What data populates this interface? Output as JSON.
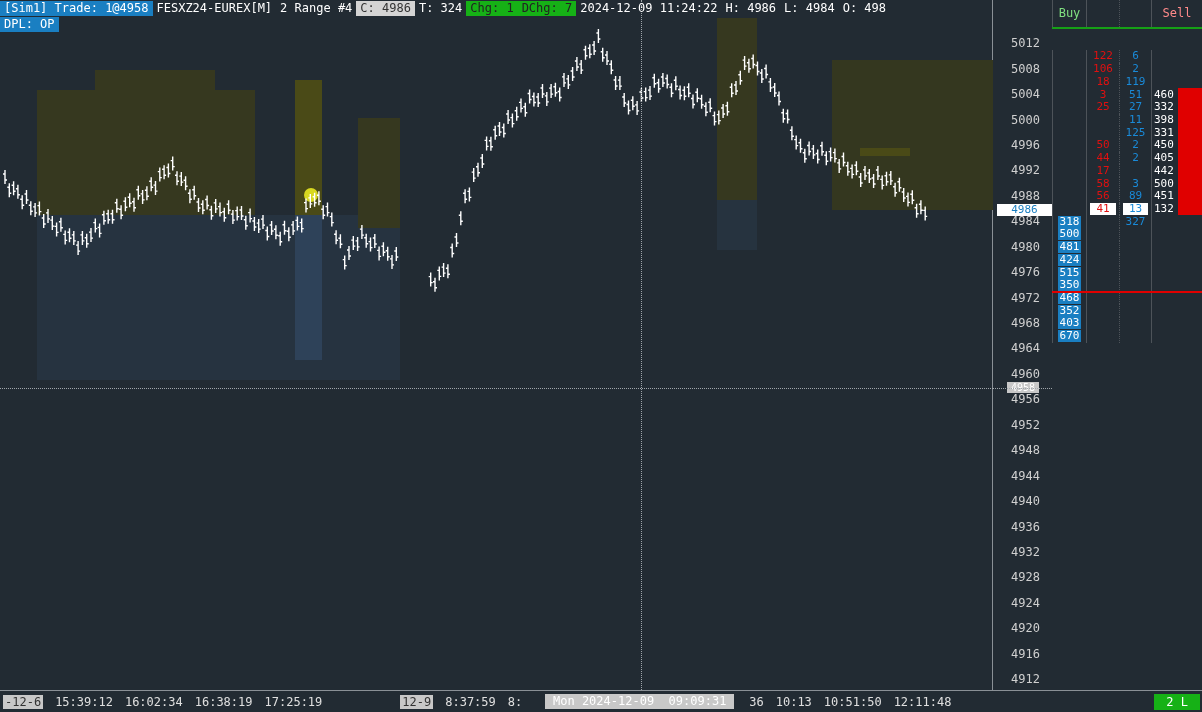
{
  "header": {
    "items": [
      {
        "text": "[Sim1]  Trade: 1@4958",
        "kind": "account"
      },
      {
        "text": "FESXZ24-EUREX[M]",
        "kind": "plain"
      },
      {
        "text": "2 Range #4",
        "kind": "plain"
      },
      {
        "text": "C: 4986",
        "kind": "last"
      },
      {
        "text": "T: 324",
        "kind": "plain"
      },
      {
        "text": "Chg: 1",
        "kind": "change"
      },
      {
        "text": "DChg: 7",
        "kind": "change"
      },
      {
        "text": "2024-12-09 11:24:22",
        "kind": "plain"
      },
      {
        "text": "H: 4986",
        "kind": "plain"
      },
      {
        "text": "L: 4984",
        "kind": "plain"
      },
      {
        "text": "O: 498",
        "kind": "plain"
      }
    ],
    "second_line": {
      "text": "DPL: OP",
      "kind": "account"
    }
  },
  "price_axis": {
    "ticks": [
      "5012",
      "5008",
      "5004",
      "5000",
      "4996",
      "4992",
      "4988",
      "4984",
      "4980",
      "4976",
      "4972",
      "4968",
      "4964",
      "4960",
      "4956",
      "4952",
      "4948",
      "4944",
      "4940",
      "4936",
      "4932",
      "4928",
      "4924",
      "4920",
      "4916",
      "4912"
    ],
    "last_price": "4986",
    "cursor_price": "4958"
  },
  "ladder": {
    "headers": {
      "column_1": "Buy",
      "column_4": "Sell"
    },
    "rows": [
      {
        "column_2": "122",
        "column_3": "6"
      },
      {
        "column_2": "106",
        "column_3": "2"
      },
      {
        "column_2": "18",
        "column_3": "119"
      },
      {
        "column_2": "3",
        "column_3": "51",
        "column_4": "460"
      },
      {
        "column_2": "25",
        "column_3": "27",
        "column_4": "332"
      },
      {
        "column_3": "11",
        "column_4": "398"
      },
      {
        "column_3": "125",
        "column_4": "331"
      },
      {
        "column_2": "50",
        "column_3": "2",
        "column_4": "450"
      },
      {
        "column_2": "44",
        "column_3": "2",
        "column_4": "405"
      },
      {
        "column_2": "17",
        "column_4": "442"
      },
      {
        "column_2": "58",
        "column_3": "3",
        "column_4": "500"
      },
      {
        "column_2": "56",
        "column_3": "89",
        "column_4": "451"
      },
      {
        "highlighted": true,
        "column_2": "41",
        "column_3": "13",
        "column_4": "132"
      },
      {
        "column_1": "318",
        "column_3": "327"
      },
      {
        "column_1": "500"
      },
      {
        "column_1": "481"
      },
      {
        "column_1": "424"
      },
      {
        "column_1": "515"
      },
      {
        "column_1": "350"
      },
      {
        "column_1": "468",
        "marker_line": true
      },
      {
        "column_1": "352"
      },
      {
        "column_1": "403"
      },
      {
        "column_1": "670"
      }
    ]
  },
  "time_axis": {
    "labels": [
      {
        "text": "-12-6",
        "kind": "date"
      },
      {
        "text": "15:39:12",
        "kind": "time"
      },
      {
        "text": "16:02:34",
        "kind": "time"
      },
      {
        "text": "16:38:19",
        "kind": "time"
      },
      {
        "text": "17:25:19",
        "kind": "time"
      },
      {
        "text": "12-9",
        "kind": "date"
      },
      {
        "text": "8:37:59",
        "kind": "time"
      },
      {
        "text": "8:",
        "kind": "time"
      },
      {
        "text": "36",
        "kind": "gap"
      },
      {
        "text": "10:13",
        "kind": "time"
      },
      {
        "text": "10:51:50",
        "kind": "time"
      },
      {
        "text": "12:11:48",
        "kind": "time"
      }
    ],
    "cursor_time": "Mon 2024-12-09  09:09:31"
  },
  "status_badge": "2 L"
}
